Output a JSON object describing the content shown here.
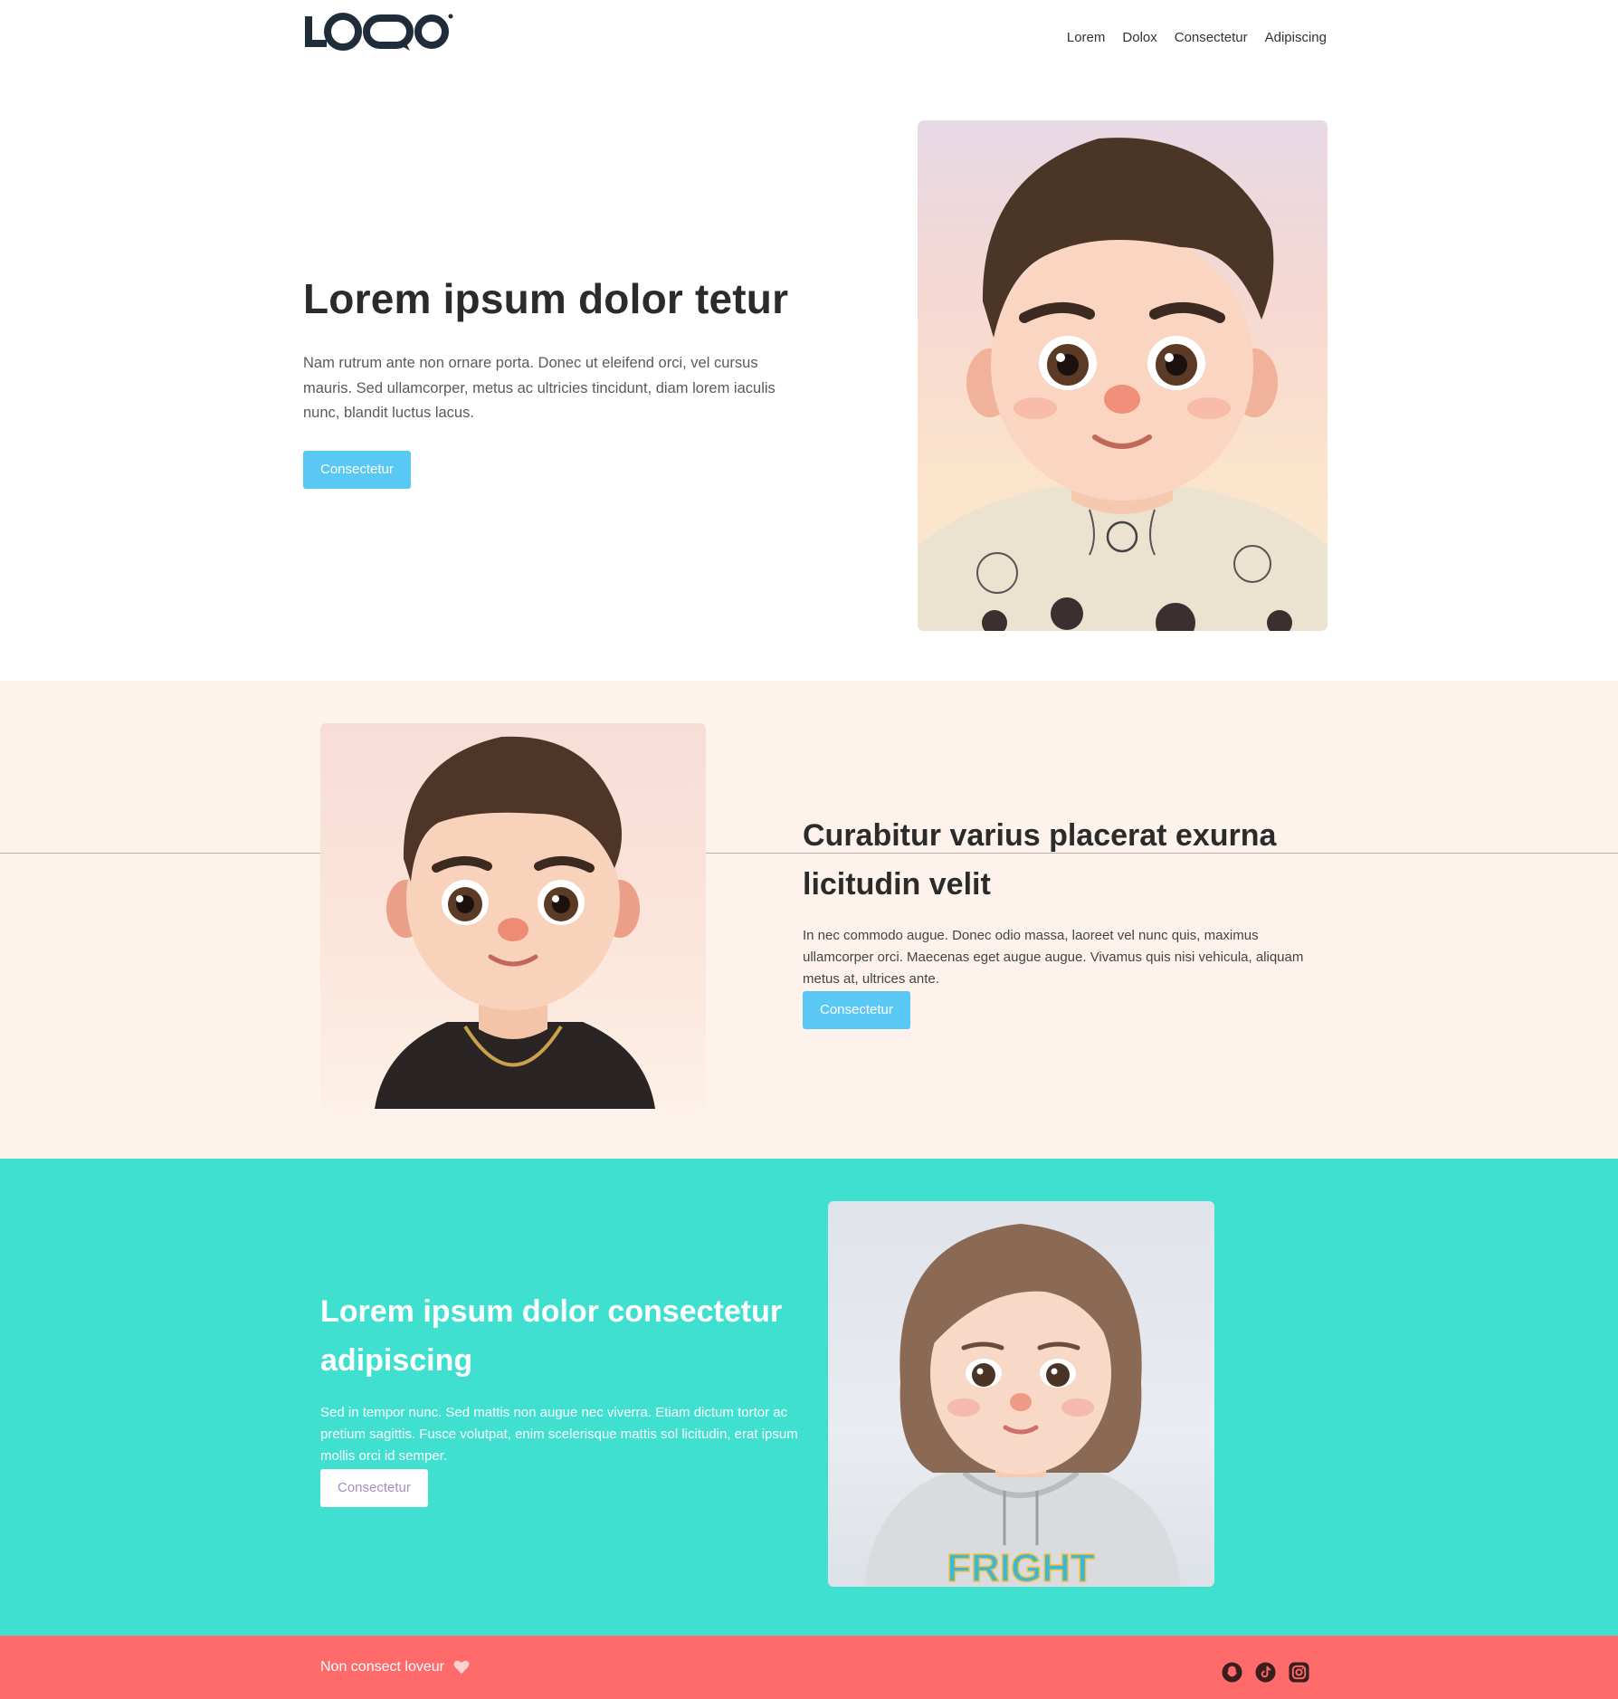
{
  "header": {
    "logo_text": "LOGO",
    "nav": [
      "Lorem",
      "Dolox",
      "Consectetur",
      "Adipiscing"
    ]
  },
  "hero": {
    "title": "Lorem ipsum dolor tetur",
    "text": "Nam rutrum ante non ornare porta. Donec ut eleifend orci, vel cursus mauris. Sed ullamcorper, metus ac ultricies tincidunt, diam lorem iaculis nunc, blandit luctus lacus.",
    "button": "Consectetur",
    "image": "cartoon-boy-tattoos-portrait"
  },
  "section2": {
    "title": "Curabitur varius placerat exurna licitudin velit",
    "text": "In nec commodo augue. Donec odio massa, laoreet vel nunc quis, maximus ullamcorper orci. Maecenas eget augue augue. Vivamus quis nisi vehicula, aliquam metus at, ultrices ante.",
    "button": "Consectetur",
    "image": "cartoon-boy-chain-portrait"
  },
  "section3": {
    "title": "Lorem ipsum dolor consectetur adipiscing",
    "text": "Sed in tempor nunc. Sed mattis non augue nec viverra. Etiam dictum tortor ac pretium sagittis. Fusce volutpat, enim scelerisque mattis sol licitudin, erat ipsum mollis orci id semper.",
    "button": "Consectetur",
    "image": "cartoon-girl-hoodie-portrait",
    "hoodie_text": "FRIGHT"
  },
  "footer": {
    "text": "Non consect loveur",
    "icons": [
      "snapchat-icon",
      "tiktok-icon",
      "instagram-icon"
    ]
  },
  "colors": {
    "accent_blue": "#5ac8f5",
    "section2_bg": "#fdf2ec",
    "section3_bg": "#40e0d0",
    "footer_bg": "#ff6b6b",
    "text_dark": "#2b2b2b"
  }
}
